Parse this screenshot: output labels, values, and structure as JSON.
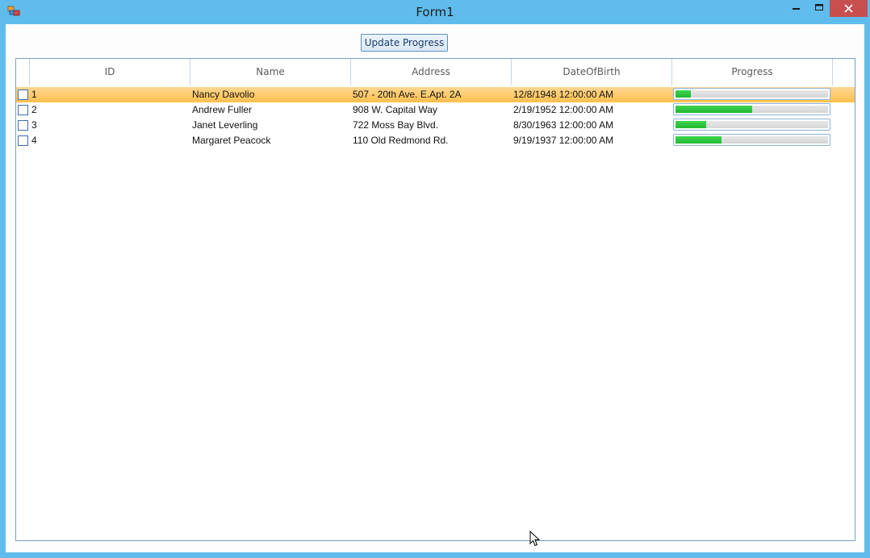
{
  "window": {
    "title": "Form1"
  },
  "toolbar": {
    "update_label": "Update Progress"
  },
  "grid": {
    "columns": [
      "ID",
      "Name",
      "Address",
      "DateOfBirth",
      "Progress"
    ],
    "rows": [
      {
        "id": "1",
        "name": "Nancy Davolio",
        "address": "507 - 20th Ave. E.Apt. 2A",
        "dob": "12/8/1948 12:00:00 AM",
        "progress": 0.1,
        "selected": true
      },
      {
        "id": "2",
        "name": "Andrew Fuller",
        "address": "908 W. Capital Way",
        "dob": "2/19/1952 12:00:00 AM",
        "progress": 0.5,
        "selected": false
      },
      {
        "id": "3",
        "name": "Janet Leverling",
        "address": "722 Moss Bay Blvd.",
        "dob": "8/30/1963 12:00:00 AM",
        "progress": 0.2,
        "selected": false
      },
      {
        "id": "4",
        "name": "Margaret Peacock",
        "address": "110 Old Redmond Rd.",
        "dob": "9/19/1937 12:00:00 AM",
        "progress": 0.3,
        "selected": false
      }
    ]
  },
  "colors": {
    "titlebar": "#5fbcec",
    "close": "#c74f4f",
    "selected_row": "#ffc04d",
    "progress_fill": "#22b832"
  }
}
